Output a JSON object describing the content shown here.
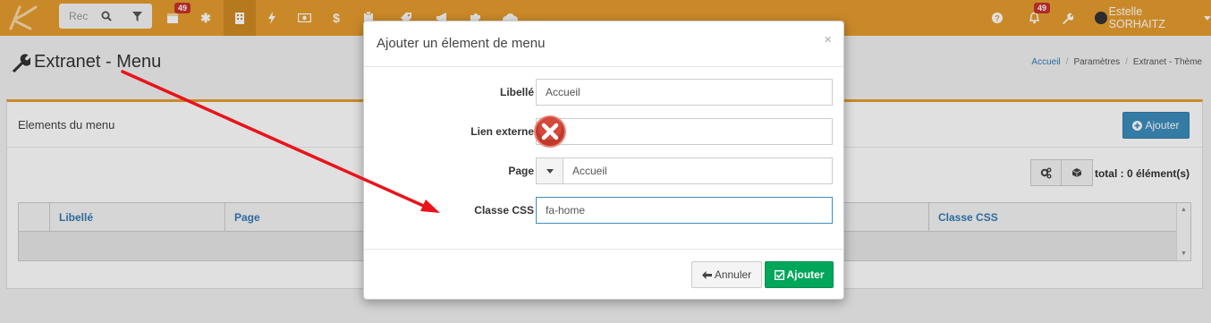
{
  "navbar": {
    "search_placeholder": "Rec",
    "calendar_badge": "49",
    "notifications_badge": "49",
    "user_name": "Estelle SORHAITZ",
    "icons": [
      "search-icon",
      "filter-icon",
      "calendar-icon",
      "asterisk-icon",
      "building-icon",
      "bolt-icon",
      "money-icon",
      "dollar-icon",
      "clipboard-icon",
      "tag-icon",
      "megaphone-icon",
      "puzzle-icon",
      "cloud-icon",
      "help-icon",
      "bell-icon",
      "wrench-icon"
    ]
  },
  "page": {
    "title": "Extranet - Menu",
    "breadcrumb": [
      "Accueil",
      "Paramètres",
      "Extranet - Thème"
    ]
  },
  "panel": {
    "title": "Elements du menu",
    "add_button": "Ajouter",
    "total_label": "total : 0 élément(s)",
    "columns": [
      "Libellé",
      "Page",
      "Classe CSS"
    ]
  },
  "modal": {
    "title": "Ajouter un élement de menu",
    "close": "×",
    "fields": {
      "libelle": {
        "label": "Libellé",
        "value": "Accueil"
      },
      "lien_externe": {
        "label": "Lien externe",
        "value": ""
      },
      "page": {
        "label": "Page",
        "value": "Accueil"
      },
      "classe_css": {
        "label": "Classe CSS",
        "value": "fa-home"
      }
    },
    "cancel_button": "Annuler",
    "ok_button": "Ajouter"
  },
  "colors": {
    "navbar": "#e69c2e",
    "primary": "#3c8dbc",
    "success": "#00a65a",
    "danger": "#c9302c",
    "annotation_arrow": "#e8141b"
  }
}
